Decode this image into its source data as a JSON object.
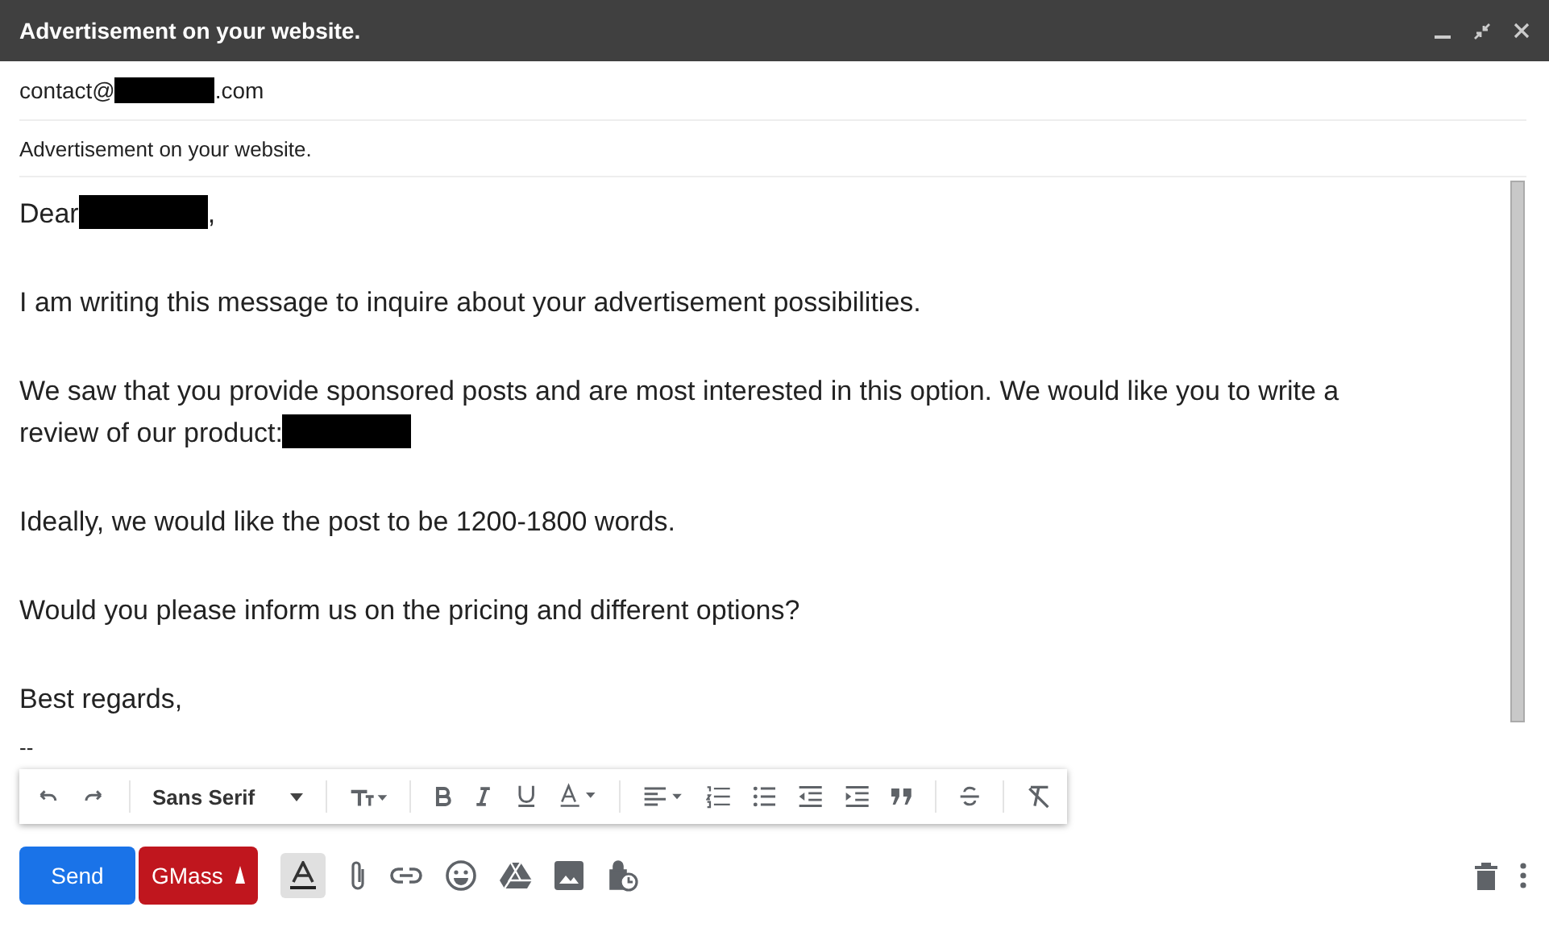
{
  "window": {
    "title": "Advertisement on your website."
  },
  "to": {
    "before": "contact@",
    "after": ".com"
  },
  "subject": "Advertisement on your website.",
  "body": [
    [
      [
        {
          "kind": "text",
          "text": "Dear"
        },
        {
          "kind": "redacted"
        },
        {
          "kind": "text",
          "text": ","
        }
      ]
    ],
    [
      [
        {
          "kind": "text",
          "text": "I am writing this message to inquire about your advertisement possibilities."
        }
      ]
    ],
    [
      [
        {
          "kind": "text",
          "text": "We saw that you provide sponsored posts and are most interested in this option. We would like you to write a"
        }
      ],
      [
        {
          "kind": "text",
          "text": "review of our product:"
        },
        {
          "kind": "redacted"
        }
      ]
    ],
    [
      [
        {
          "kind": "text",
          "text": "Ideally, we would like the post to be 1200-1800 words."
        }
      ]
    ],
    [
      [
        {
          "kind": "text",
          "text": "Would you please inform us on the pricing and different options?"
        }
      ]
    ],
    [
      [
        {
          "kind": "text",
          "text": "Best regards,"
        }
      ]
    ]
  ],
  "signature_separator": "--",
  "format_toolbar": {
    "font": "Sans Serif"
  },
  "send_bar": {
    "send": "Send",
    "gmass": "GMass",
    "text_formatting_selected": true
  }
}
